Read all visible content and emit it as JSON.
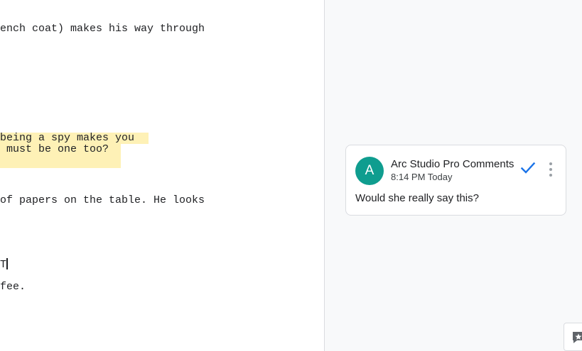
{
  "script": {
    "lines": [
      "ench coat) makes his way through",
      "being a spy makes you",
      " must be one too?",
      "of papers on the table. He looks",
      "T",
      "fee."
    ]
  },
  "comment": {
    "avatar_letter": "A",
    "author": "Arc Studio Pro Comments",
    "timestamp": "8:14 PM Today",
    "text": "Would she really say this?"
  },
  "icons": {
    "resolve": "checkmark-icon",
    "more": "more-vertical-icon",
    "side_widget": "add-comment-icon"
  },
  "colors": {
    "highlight": "#fef1b6",
    "avatar": "#0f9d8f",
    "resolve_check": "#1a73e8"
  }
}
